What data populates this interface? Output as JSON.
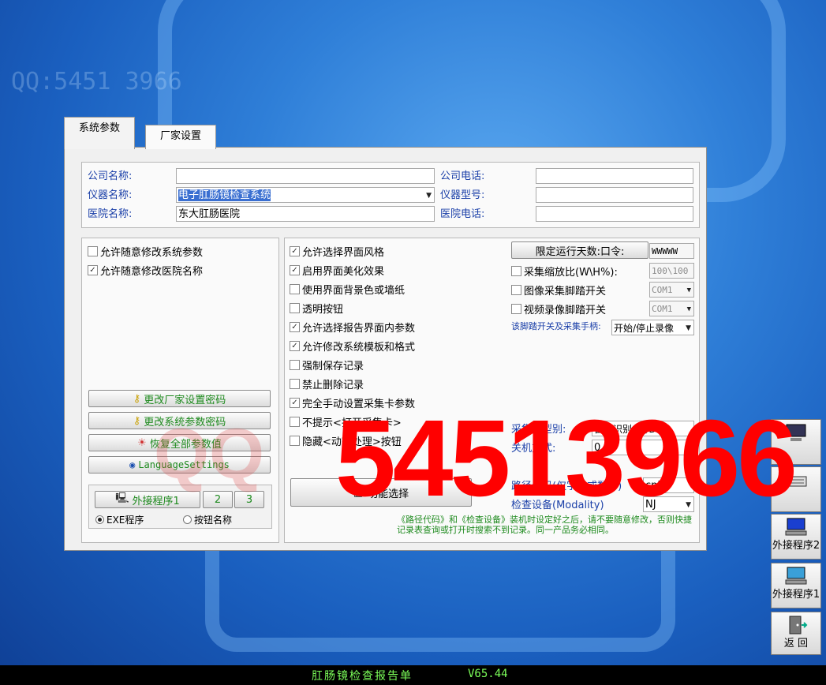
{
  "background": {
    "qq_text": "QQ:5451 3966"
  },
  "tabs": [
    {
      "label": "系统参数"
    },
    {
      "label": "厂家设置"
    }
  ],
  "company": {
    "company_name_label": "公司名称:",
    "company_name_value": "",
    "device_name_label": "仪器名称:",
    "device_name_value": "电子肛肠镜检查系统",
    "hospital_name_label": "医院名称:",
    "hospital_name_value": "东大肛肠医院",
    "company_phone_label": "公司电话:",
    "company_phone_value": "",
    "device_model_label": "仪器型号:",
    "device_model_value": "",
    "hospital_phone_label": "医院电话:",
    "hospital_phone_value": ""
  },
  "left_checks": [
    {
      "label": "允许随意修改系统参数",
      "checked": false
    },
    {
      "label": "允许随意修改医院名称",
      "checked": true
    }
  ],
  "left_buttons": {
    "change_factory_pwd": "更改厂家设置密码",
    "change_system_pwd": "更改系统参数密码",
    "restore_defaults": "恢复全部参数值",
    "language": "LanguageSettings"
  },
  "external": {
    "program1": "外接程序1",
    "program2": "2",
    "program3": "3",
    "radio_exe": "EXE程序",
    "radio_name": "按钮名称"
  },
  "mid_checks": [
    {
      "label": "允许选择界面风格",
      "checked": true
    },
    {
      "label": "启用界面美化效果",
      "checked": true
    },
    {
      "label": "使用界面背景色或墙纸",
      "checked": false
    },
    {
      "label": "透明按钮",
      "checked": false
    },
    {
      "label": "允许选择报告界面内参数",
      "checked": true
    },
    {
      "label": "允许修改系统模板和格式",
      "checked": true
    },
    {
      "label": "强制保存记录",
      "checked": false
    },
    {
      "label": "禁止删除记录",
      "checked": false
    },
    {
      "label": "完全手动设置采集卡参数",
      "checked": true
    },
    {
      "label": "不提示<打开采集卡>",
      "checked": false
    },
    {
      "label": "隐藏<动态处理>按钮",
      "checked": false
    }
  ],
  "function_select": "功能选择",
  "right": {
    "run_days_button": "限定运行天数:口令:",
    "run_days_value": "WWWWW",
    "scale_label": "采集缩放比(W\\H%):",
    "scale_value": "100\\100",
    "image_pedal_label": "图像采集脚踏开关",
    "image_pedal_value": "COM1",
    "video_pedal_label": "视频录像脚踏开关",
    "video_pedal_value": "COM1",
    "pedal_note": "该脚踏开关及采集手柄:",
    "pedal_mode": "开始/停止录像",
    "capture_label": "采集卡型别:",
    "capture_value": "自动识别OK/D",
    "shutdown_label": "关机方式:",
    "shutdown_value": "0",
    "path_label": "路径代码(仅字母或数字)",
    "path_value": "cnj",
    "device_label": "检查设备(Modality)",
    "device_value": "NJ",
    "warning": "《路径代码》和《检查设备》装机时设定好之后，请不要随意修改，否则快捷记录表查询或打开时搜索不到记录。同一产品务必相同。"
  },
  "side_buttons": [
    {
      "label": "外接程序2"
    },
    {
      "label": "外接程序1"
    },
    {
      "label": "返 回"
    }
  ],
  "overlay_number": "54513966",
  "status_bar": {
    "title": "肛肠镜检查报告单",
    "version": "V65.44"
  },
  "colors": {
    "label_blue": "#1a3fa8",
    "green_text": "#1e8a1e",
    "overlay_red": "#ff0000",
    "status_green": "#7cff5a"
  }
}
